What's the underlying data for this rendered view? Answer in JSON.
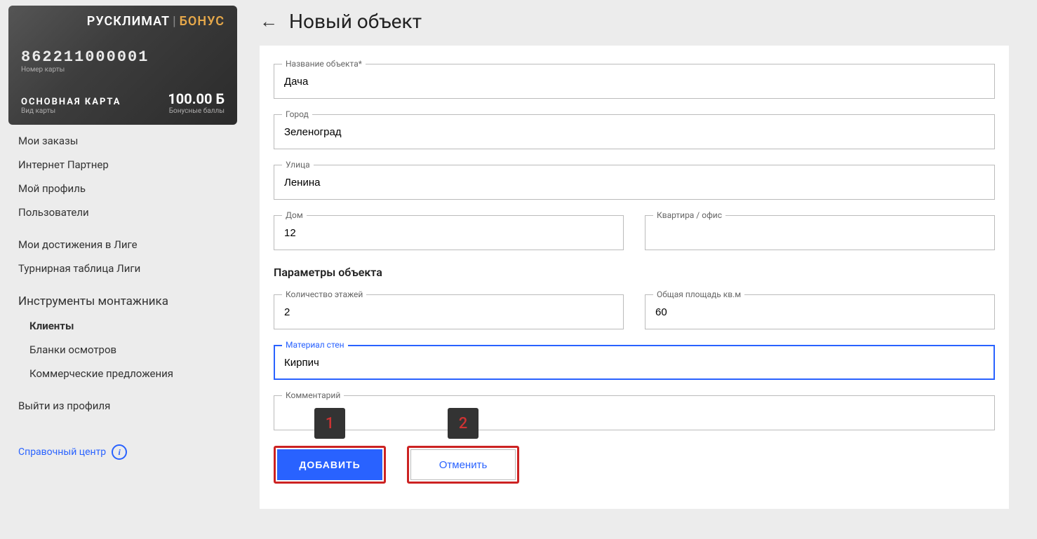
{
  "card": {
    "logo_main": "РУСКЛИМАТ",
    "logo_bonus": "БОНУС",
    "number": "862211000001",
    "number_label": "Номер карты",
    "type": "ОСНОВНАЯ КАРТА",
    "type_label": "Вид карты",
    "balance": "100.00 Б",
    "balance_label": "Бонусные баллы"
  },
  "nav": {
    "orders": "Мои заказы",
    "partner": "Интернет Партнер",
    "profile": "Мой профиль",
    "users": "Пользователи",
    "achievements": "Мои достижения в Лиге",
    "tournament": "Турнирная таблица Лиги",
    "tools_header": "Инструменты монтажника",
    "clients": "Клиенты",
    "inspection_forms": "Бланки осмотров",
    "commercial_offers": "Коммерческие предложения",
    "logout": "Выйти из профиля",
    "help": "Справочный центр"
  },
  "page": {
    "title": "Новый объект"
  },
  "form": {
    "object_name": {
      "label": "Название объекта*",
      "value": "Дача"
    },
    "city": {
      "label": "Город",
      "value": "Зеленоград"
    },
    "street": {
      "label": "Улица",
      "value": "Ленина"
    },
    "house": {
      "label": "Дом",
      "value": "12"
    },
    "apartment": {
      "label": "Квартира / офис",
      "value": ""
    },
    "params_heading": "Параметры объекта",
    "floors": {
      "label": "Количество этажей",
      "value": "2"
    },
    "area": {
      "label": "Общая площадь кв.м",
      "value": "60"
    },
    "wall_material": {
      "label": "Материал стен",
      "value": "Кирпич"
    },
    "comment": {
      "label": "Комментарий",
      "value": ""
    }
  },
  "buttons": {
    "add": "ДОБАВИТЬ",
    "cancel": "Отменить"
  },
  "callouts": {
    "one": "1",
    "two": "2"
  }
}
